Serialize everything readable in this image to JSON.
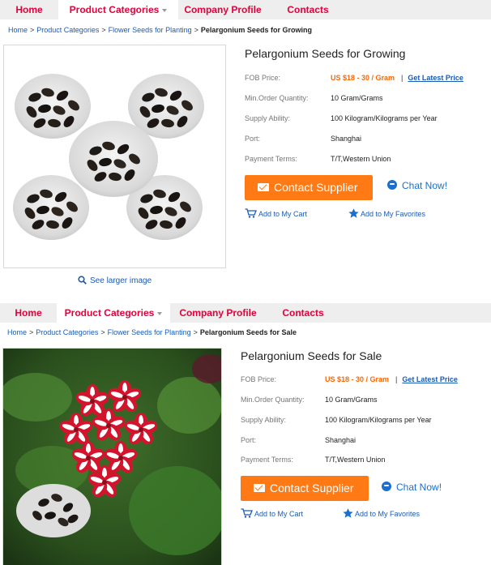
{
  "nav": {
    "home": "Home",
    "product_categories": "Product Categories",
    "company_profile": "Company Profile",
    "contacts": "Contacts"
  },
  "listings": [
    {
      "breadcrumb": {
        "home": "Home",
        "product_categories": "Product Categories",
        "flower_seeds": "Flower Seeds for Planting",
        "current": "Pelargonium Seeds for Growing"
      },
      "title": "Pelargonium Seeds for Growing",
      "specs": {
        "fob_label": "FOB Price:",
        "fob_value": "US $18 - 30 / Gram",
        "latest_price": "Get Latest Price",
        "moq_label": "Min.Order Quantity:",
        "moq_value": "10 Gram/Grams",
        "supply_label": "Supply Ability:",
        "supply_value": "100 Kilogram/Kilograms per Year",
        "port_label": "Port:",
        "port_value": "Shanghai",
        "payment_label": "Payment Terms:",
        "payment_value": "T/T,Western Union"
      },
      "contact_supplier": "Contact Supplier",
      "chat_now": "Chat Now!",
      "add_to_cart": "Add to My Cart",
      "add_to_favorites": "Add to My Favorites",
      "see_larger": "See larger image"
    },
    {
      "breadcrumb": {
        "home": "Home",
        "product_categories": "Product Categories",
        "flower_seeds": "Flower Seeds for Planting",
        "current": "Pelargonium Seeds for Sale"
      },
      "title": "Pelargonium Seeds for Sale",
      "specs": {
        "fob_label": "FOB Price:",
        "fob_value": "US $18 - 30 / Gram",
        "latest_price": "Get Latest Price",
        "moq_label": "Min.Order Quantity:",
        "moq_value": "10 Gram/Grams",
        "supply_label": "Supply Ability:",
        "supply_value": "100 Kilogram/Kilograms per Year",
        "port_label": "Port:",
        "port_value": "Shanghai",
        "payment_label": "Payment Terms:",
        "payment_value": "T/T,Western Union"
      },
      "contact_supplier": "Contact Supplier",
      "chat_now": "Chat Now!",
      "add_to_cart": "Add to My Cart",
      "add_to_favorites": "Add to My Favorites"
    }
  ],
  "icons": {
    "cart": "cart-icon",
    "star": "star-icon",
    "envelope": "envelope-icon",
    "chat": "chat-bubble-icon",
    "magnifier": "magnifier-icon"
  },
  "colors": {
    "nav_red": "#e4003a",
    "accent_orange": "#ff7a14",
    "price_orange": "#ff6600",
    "link_blue": "#1a5bb5"
  }
}
